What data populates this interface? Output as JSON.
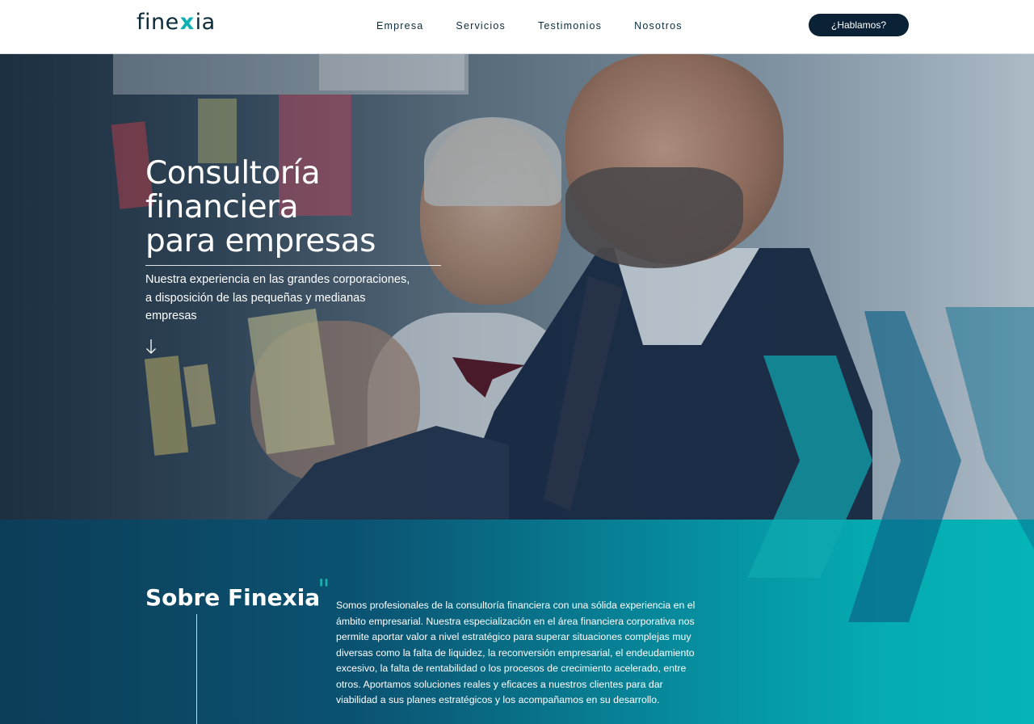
{
  "header": {
    "logo": {
      "left": "fine",
      "mark": "x",
      "right": "ia"
    },
    "nav": [
      "Empresa",
      "Servicios",
      "Testimonios",
      "Nosotros"
    ],
    "cta_label": "¿Hablamos?"
  },
  "hero": {
    "title_lines": [
      "Consultoría",
      "financiera",
      "para empresas"
    ],
    "subtitle": "Nuestra experiencia en las grandes corporaciones, a disposición de las pequeñas y medianas empresas",
    "scroll_icon": "arrow-down-icon"
  },
  "about": {
    "title": "Sobre Finexia",
    "quote_mark": "\"",
    "text": "Somos profesionales de la consultoría financiera con una sólida experiencia en el ámbito empresarial. Nuestra especialización en el área financiera corporativa nos permite aportar valor a nivel estratégico para superar situaciones complejas muy diversas como la falta de liquidez, la reconversión empresarial, el endeudamiento excesivo, la falta de rentabilidad o los procesos de crecimiento acelerado, entre otros. Aportamos soluciones reales y eficaces a nuestros clientes para dar viabilidad a sus planes estratégicos y los acompañamos en su desarrollo."
  },
  "colors": {
    "brand_dark": "#0b2236",
    "brand_teal": "#0fb0b2",
    "about_gradient_start": "#0c3d58",
    "about_gradient_end": "#05b4b6"
  }
}
